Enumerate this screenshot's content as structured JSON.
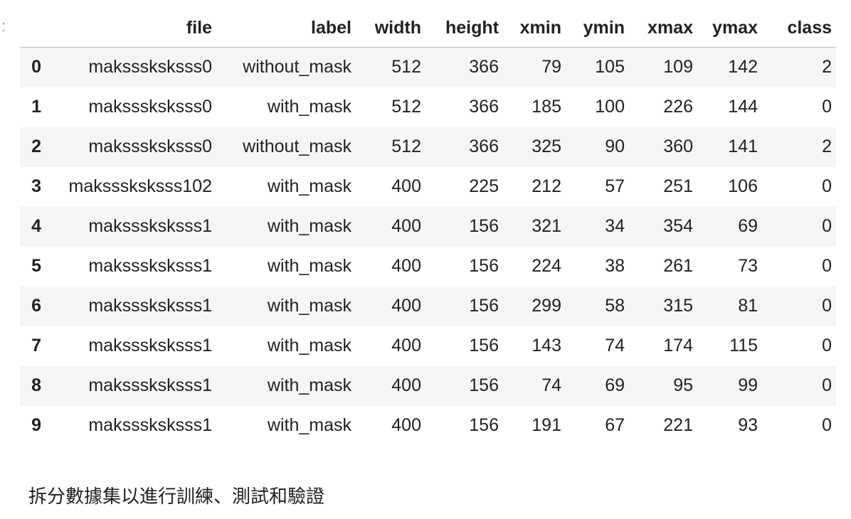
{
  "prompt_marker": ":",
  "dataframe": {
    "columns": [
      "file",
      "label",
      "width",
      "height",
      "xmin",
      "ymin",
      "xmax",
      "ymax",
      "class"
    ],
    "rows": [
      {
        "index": "0",
        "cells": [
          "maksssksksss0",
          "without_mask",
          "512",
          "366",
          "79",
          "105",
          "109",
          "142",
          "2"
        ]
      },
      {
        "index": "1",
        "cells": [
          "maksssksksss0",
          "with_mask",
          "512",
          "366",
          "185",
          "100",
          "226",
          "144",
          "0"
        ]
      },
      {
        "index": "2",
        "cells": [
          "maksssksksss0",
          "without_mask",
          "512",
          "366",
          "325",
          "90",
          "360",
          "141",
          "2"
        ]
      },
      {
        "index": "3",
        "cells": [
          "maksssksksss102",
          "with_mask",
          "400",
          "225",
          "212",
          "57",
          "251",
          "106",
          "0"
        ]
      },
      {
        "index": "4",
        "cells": [
          "maksssksksss1",
          "with_mask",
          "400",
          "156",
          "321",
          "34",
          "354",
          "69",
          "0"
        ]
      },
      {
        "index": "5",
        "cells": [
          "maksssksksss1",
          "with_mask",
          "400",
          "156",
          "224",
          "38",
          "261",
          "73",
          "0"
        ]
      },
      {
        "index": "6",
        "cells": [
          "maksssksksss1",
          "with_mask",
          "400",
          "156",
          "299",
          "58",
          "315",
          "81",
          "0"
        ]
      },
      {
        "index": "7",
        "cells": [
          "maksssksksss1",
          "with_mask",
          "400",
          "156",
          "143",
          "74",
          "174",
          "115",
          "0"
        ]
      },
      {
        "index": "8",
        "cells": [
          "maksssksksss1",
          "with_mask",
          "400",
          "156",
          "74",
          "69",
          "95",
          "99",
          "0"
        ]
      },
      {
        "index": "9",
        "cells": [
          "maksssksksss1",
          "with_mask",
          "400",
          "156",
          "191",
          "67",
          "221",
          "93",
          "0"
        ]
      }
    ]
  },
  "markdown_text": "拆分數據集以進行訓練、測試和驗證"
}
